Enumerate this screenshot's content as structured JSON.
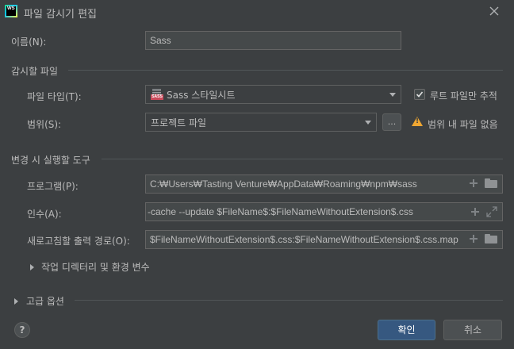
{
  "window": {
    "app_logo_text": "WS",
    "title": "파일 감시기 편집",
    "close_icon": "close-icon"
  },
  "name": {
    "label": "이름(N):",
    "value": "Sass"
  },
  "watch_section": {
    "title": "감시할 파일",
    "file_type_label": "파일 타입(T):",
    "file_type_value": "Sass 스타일시트",
    "file_type_icon_tag": "SASS",
    "root_only_label": "루트 파일만 추적",
    "root_only_checked": true,
    "scope_label": "범위(S):",
    "scope_value": "프로젝트 파일",
    "scope_more_button": "...",
    "warning_text": "범위 내 파일 없음",
    "warning_color": "#f0a732"
  },
  "tool_section": {
    "title": "변경 시 실행할 도구",
    "program_label": "프로그램(P):",
    "program_value": "C:₩Users₩Tasting Venture₩AppData₩Roaming₩npm₩sass",
    "args_label": "인수(A):",
    "args_value": "-cache --update $FileName$:$FileNameWithoutExtension$.css",
    "refresh_label": "새로고침할 출력 경로(O):",
    "refresh_value": "$FileNameWithoutExtension$.css:$FileNameWithoutExtension$.css.map",
    "workdir_toggle_label": "작업 디렉터리 및 환경 변수"
  },
  "advanced": {
    "label": "고급 옵션"
  },
  "footer": {
    "help_label": "?",
    "ok_label": "확인",
    "cancel_label": "취소"
  },
  "colors": {
    "background": "#3c3f41",
    "primary_button": "#365880",
    "text": "#bbbbbb",
    "field_bg": "#45494a"
  }
}
